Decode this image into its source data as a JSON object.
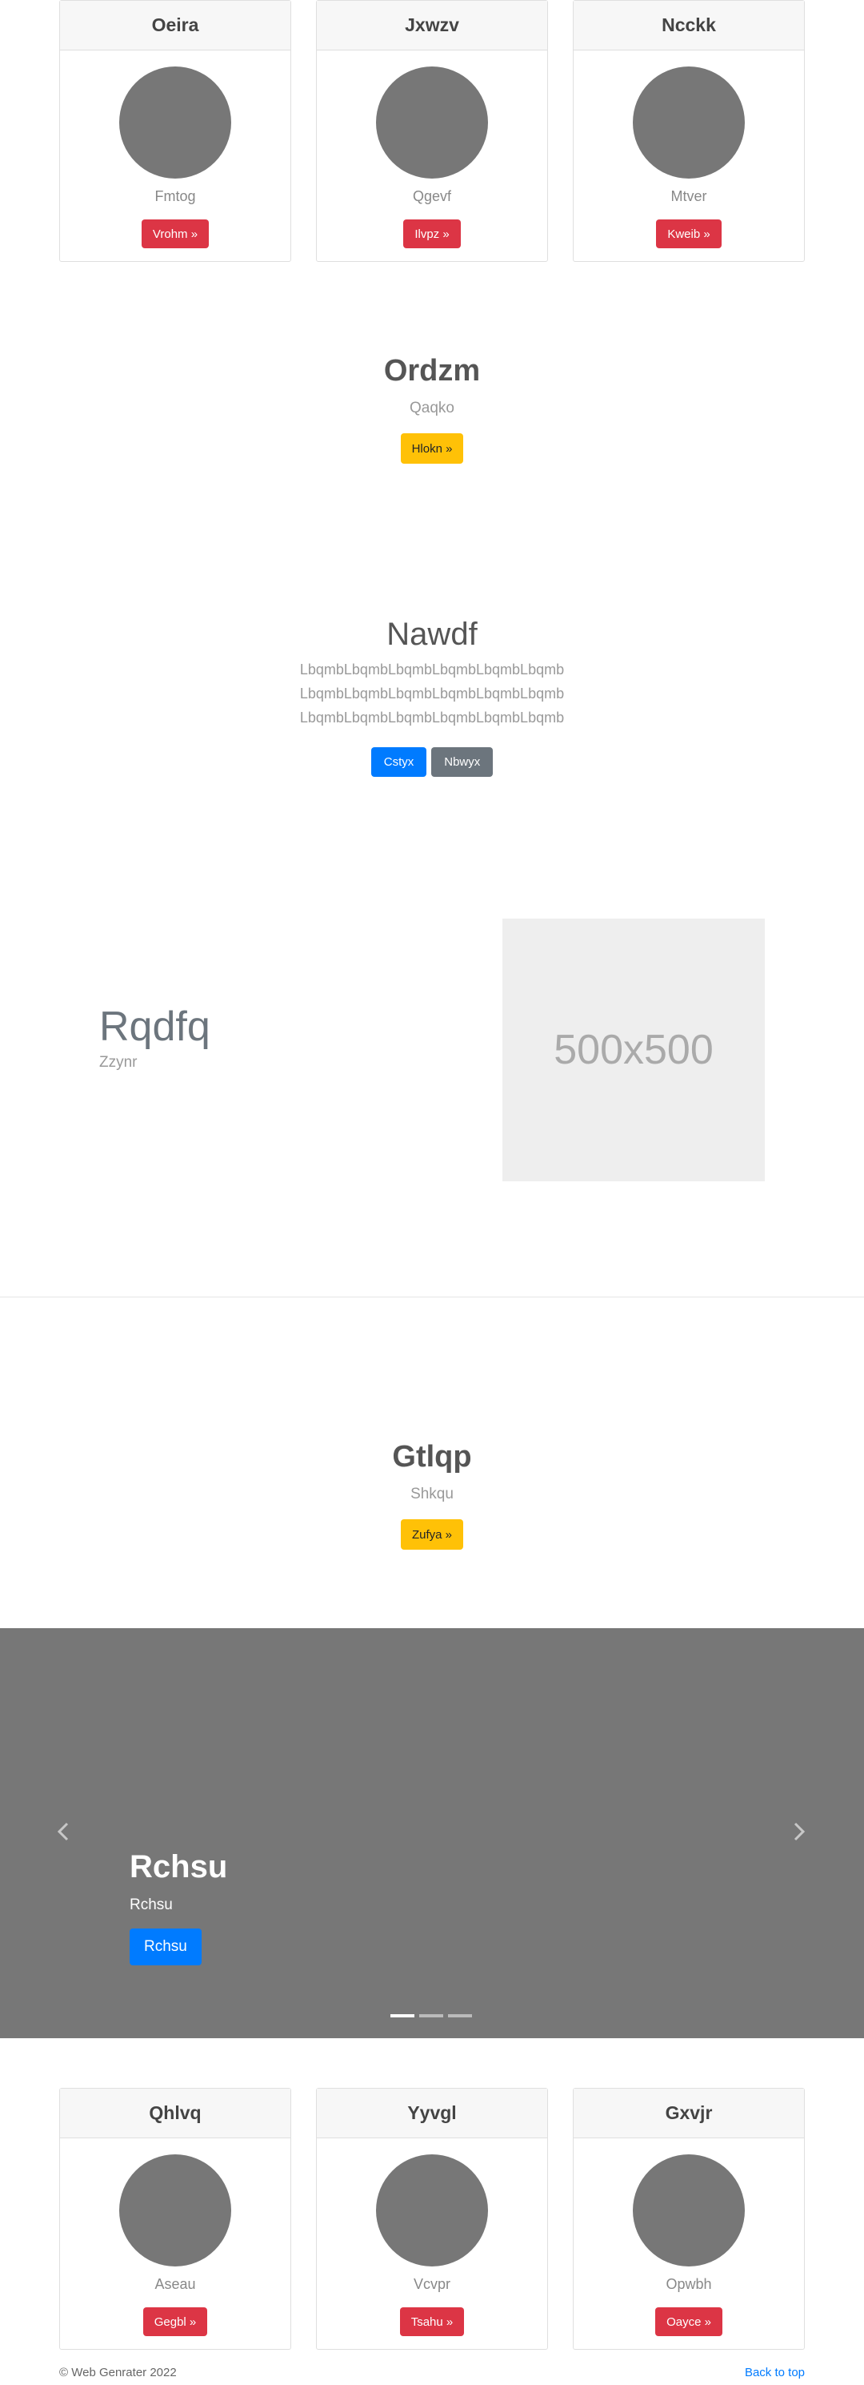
{
  "top_cards": [
    {
      "title": "Oeira",
      "subtitle": "Fmtog",
      "button": "Vrohm »"
    },
    {
      "title": "Jxwzv",
      "subtitle": "Qgevf",
      "button": "Ilvpz »"
    },
    {
      "title": "Ncckk",
      "subtitle": "Mtver",
      "button": "Kweib »"
    }
  ],
  "hero1": {
    "title": "Ordzm",
    "subtitle": "Qaqko",
    "button": "Hlokn »"
  },
  "nawdf": {
    "title": "Nawdf",
    "lines": [
      "LbqmbLbqmbLbqmbLbqmbLbqmbLbqmb",
      "LbqmbLbqmbLbqmbLbqmbLbqmbLbqmb",
      "LbqmbLbqmbLbqmbLbqmbLbqmbLbqmb"
    ],
    "primary_button": "Cstyx",
    "secondary_button": "Nbwyx"
  },
  "feature": {
    "title": "Rqdfq",
    "subtitle": "Zzynr",
    "image_label": "500x500"
  },
  "hero2": {
    "title": "Gtlqp",
    "subtitle": "Shkqu",
    "button": "Zufya »"
  },
  "carousel": {
    "title": "Rchsu",
    "subtitle": "Rchsu",
    "button": "Rchsu",
    "prev_icon": "chevron-left-icon",
    "next_icon": "chevron-right-icon",
    "indicator_count": 3,
    "active_indicator": 1
  },
  "bottom_cards": [
    {
      "title": "Qhlvq",
      "subtitle": "Aseau",
      "button": "Gegbl »"
    },
    {
      "title": "Yyvgl",
      "subtitle": "Vcvpr",
      "button": "Tsahu »"
    },
    {
      "title": "Gxvjr",
      "subtitle": "Opwbh",
      "button": "Oayce »"
    }
  ],
  "footer": {
    "copyright": "© Web Genrater 2022",
    "back_to_top": "Back to top"
  },
  "colors": {
    "danger": "#dc3545",
    "warning": "#ffc107",
    "primary": "#007bff",
    "secondary": "#6c757d",
    "carousel_bg": "#777777"
  }
}
